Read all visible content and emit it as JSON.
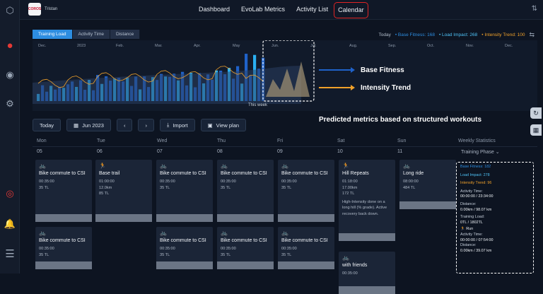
{
  "user": {
    "name": "Tristan",
    "logo_text": "COROS"
  },
  "nav": {
    "items": [
      "Dashboard",
      "EvoLab Metrics",
      "Activity List",
      "Calendar"
    ],
    "active": "Calendar"
  },
  "chart": {
    "tabs": [
      "Training Load",
      "Activity Time",
      "Distance"
    ],
    "active_tab": "Training Load",
    "months": [
      "Dec.",
      "2023",
      "Feb.",
      "Mar.",
      "Apr.",
      "May",
      "Jun.",
      "Jul.",
      "Aug.",
      "Sep.",
      "Oct.",
      "Nov.",
      "Dec."
    ],
    "this_week_label": "This week",
    "legend": {
      "today": "Today",
      "base_fitness": "• Base Fitness: 168",
      "load_impact": "• Load Impact: 268",
      "intensity_trend": "• Intensity Trend: 100"
    },
    "annotations": {
      "base_fitness": "Base Fitness",
      "intensity_trend": "Intensity Trend"
    },
    "colors": {
      "base_fitness": "#1f62c9",
      "load_impact": "#2ab0f2",
      "intensity_trend": "#f0a12a",
      "accent": "#2d8de0"
    }
  },
  "chart_data": {
    "type": "bar",
    "categories": [
      "Dec.",
      "2023",
      "Feb.",
      "Mar.",
      "Apr.",
      "May",
      "Jun.",
      "Jul.",
      "Aug.",
      "Sep.",
      "Oct.",
      "Nov.",
      "Dec."
    ],
    "series": [
      {
        "name": "Load Impact",
        "values": [
          90,
          120,
          150,
          140,
          170,
          160,
          200,
          268,
          0,
          0,
          0,
          0,
          0
        ]
      },
      {
        "name": "Base Fitness",
        "values": [
          60,
          75,
          95,
          110,
          120,
          130,
          150,
          168,
          0,
          0,
          0,
          0,
          0
        ]
      },
      {
        "name": "Intensity Trend",
        "values": [
          80,
          95,
          110,
          105,
          120,
          115,
          140,
          100,
          0,
          0,
          0,
          0,
          0
        ]
      }
    ]
  },
  "toolbar": {
    "today": "Today",
    "month": "Jun 2023",
    "import": "Import",
    "view_plan": "View plan"
  },
  "prediction_note": "Predicted metrics based on structured workouts",
  "calendar": {
    "days": [
      "Mon",
      "Tue",
      "Wed",
      "Thu",
      "Fri",
      "Sat",
      "Sun"
    ],
    "dates": [
      "05",
      "06",
      "07",
      "08",
      "09",
      "10",
      "11"
    ],
    "weekly_header": "Weekly Statistics",
    "phase_label": "Training Phase"
  },
  "workouts_row1": [
    {
      "title": "Bike commute to CSI",
      "lines": [
        "00:35:00",
        "35 TL"
      ],
      "type": "bike"
    },
    {
      "title": "Base trail",
      "lines": [
        "01:00:00",
        "12.0km",
        "85 TL"
      ],
      "type": "run"
    },
    {
      "title": "Bike commute to CSI",
      "lines": [
        "00:35:00",
        "35 TL"
      ],
      "type": "bike"
    },
    {
      "title": "Bike commute to CSI",
      "lines": [
        "00:35:00",
        "35 TL"
      ],
      "type": "bike"
    },
    {
      "title": "Bike commute to CSI",
      "lines": [
        "00:35:00",
        "35 TL"
      ],
      "type": "bike"
    },
    {
      "title": "Hill Repeats",
      "lines": [
        "01:18:00",
        "17.00km",
        "172 TL"
      ],
      "type": "run",
      "desc": "High-Intensity done on a long hill (% grade). Active recovery back down."
    },
    {
      "title": "Long ride",
      "lines": [
        "08:00:00",
        "484 TL"
      ],
      "type": "bike"
    }
  ],
  "workouts_row2": [
    {
      "title": "Bike commute to CSI",
      "lines": [
        "00:35:00",
        "35 TL"
      ]
    },
    {
      "title": "Bike commute to CSI",
      "lines": [
        "00:35:00",
        "35 TL"
      ]
    },
    {
      "title": "Bike commute to CSI",
      "lines": [
        "00:35:00",
        "35 TL"
      ]
    },
    {
      "title": "Bike commute to CSI",
      "lines": [
        "00:35:00",
        "35 TL"
      ]
    },
    {
      "title": "with friends",
      "lines": [
        "00:35:00"
      ]
    }
  ],
  "weekly_stats": {
    "base_fitness": "Base Fitness: 182",
    "load_impact": "Load Impact: 278",
    "intensity_trend": "Intensity Trend: 96",
    "activity_time_label": "Activity Time:",
    "activity_time": "00:00:00 / 23:34:00",
    "distance_label": "Distance:",
    "distance": "0.00km / 98.07 km",
    "training_load_label": "Training Load:",
    "training_load": "0TL / 1802TL",
    "run_label": "Run",
    "run_activity_time": "00:00:00 / 07:54:00",
    "run_distance": "0.00km / 39.07 km"
  }
}
